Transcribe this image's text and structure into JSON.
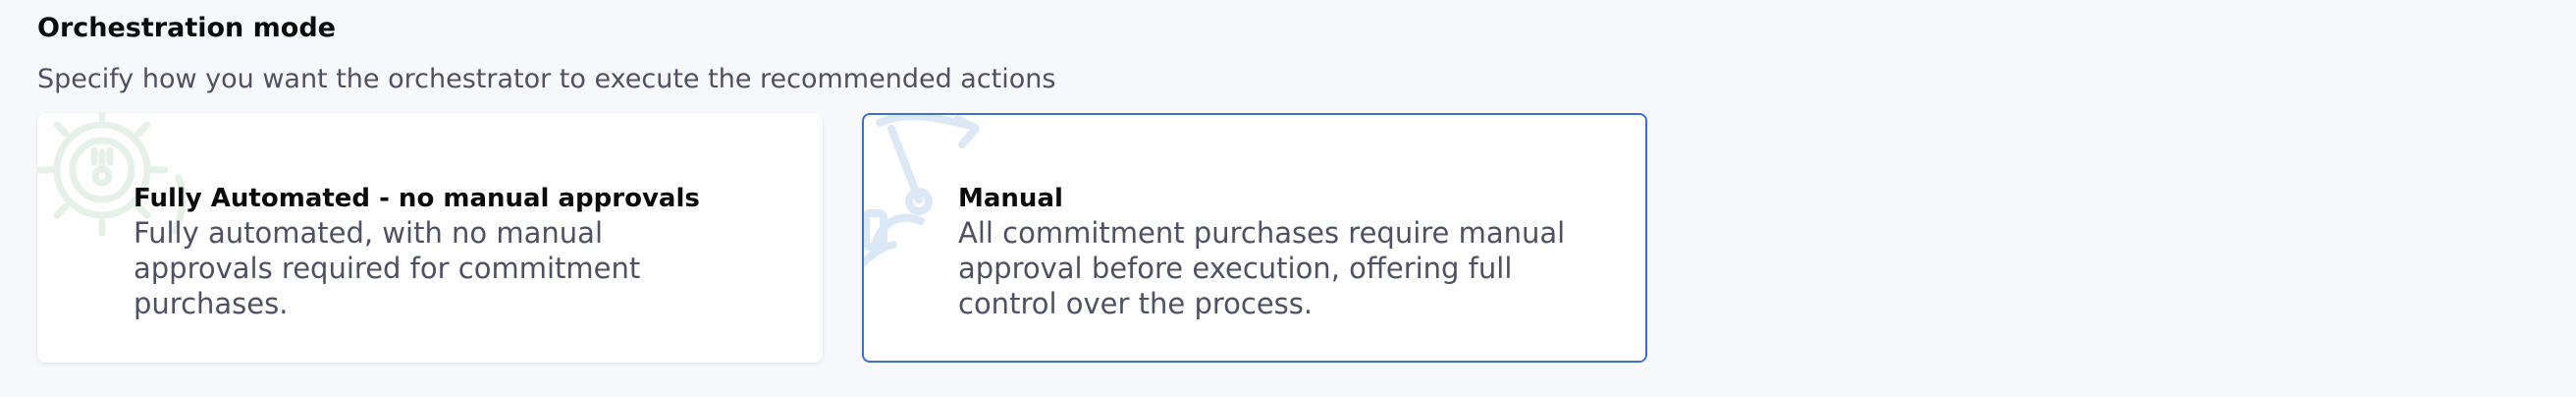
{
  "section": {
    "title": "Orchestration mode",
    "subtitle": "Specify how you want the orchestrator to execute the recommended actions"
  },
  "options": [
    {
      "icon": "automation-gear-icon",
      "title": "Fully Automated - no manual approvals",
      "description": "Fully automated, with no manual approvals required for commitment purchases.",
      "selected": false
    },
    {
      "icon": "manual-lever-icon",
      "title": "Manual",
      "description": "All commitment purchases require manual approval before execution, offering full control over the process.",
      "selected": true
    }
  ],
  "colors": {
    "background": "#f8f9fd",
    "selected_border": "#3b6fd9",
    "title_text": "#0b0b0c",
    "secondary_text": "#4f5162",
    "watermark_icon": "#dbe9f6"
  }
}
